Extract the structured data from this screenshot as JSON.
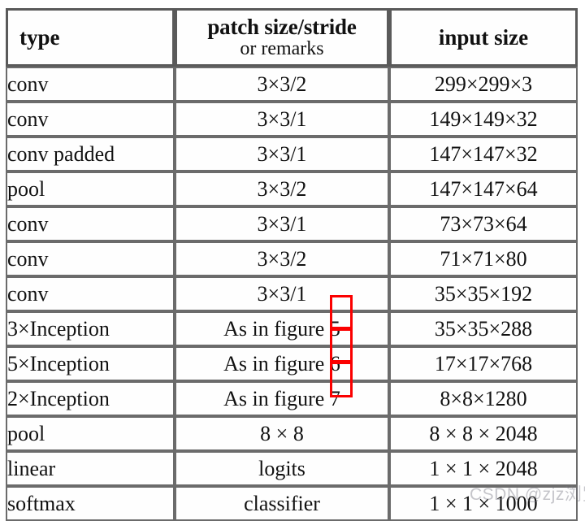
{
  "table": {
    "columns": [
      {
        "key": "type",
        "label": "type"
      },
      {
        "key": "patch",
        "label_line1": "patch size/stride",
        "label_line2": "or remarks"
      },
      {
        "key": "input",
        "label": "input size"
      }
    ],
    "rows": [
      {
        "type": "conv",
        "patch": "3×3/2",
        "input": "299×299×3"
      },
      {
        "type": "conv",
        "patch": "3×3/1",
        "input": "149×149×32"
      },
      {
        "type": "conv padded",
        "patch": "3×3/1",
        "input": "147×147×32"
      },
      {
        "type": "pool",
        "patch": "3×3/2",
        "input": "147×147×64"
      },
      {
        "type": "conv",
        "patch": "3×3/1",
        "input": "73×73×64"
      },
      {
        "type": "conv",
        "patch": "3×3/2",
        "input": "71×71×80"
      },
      {
        "type": "conv",
        "patch": "3×3/1",
        "input": "35×35×192"
      },
      {
        "type": "3×Inception",
        "patch": "As in figure 5",
        "input": "35×35×288"
      },
      {
        "type": "5×Inception",
        "patch": "As in figure 6",
        "input": "17×17×768"
      },
      {
        "type": "2×Inception",
        "patch": "As in figure 7",
        "input": "8×8×1280"
      },
      {
        "type": "pool",
        "patch": "8 × 8",
        "input": "8 × 8 × 2048"
      },
      {
        "type": "linear",
        "patch": "logits",
        "input": "1 × 1 × 2048"
      },
      {
        "type": "softmax",
        "patch": "classifier",
        "input": "1 × 1 × 1000"
      }
    ]
  },
  "annotations": {
    "highlight_color": "#fb0000",
    "boxes": [
      {
        "id": "fig-box-5",
        "target": "figure number 5"
      },
      {
        "id": "fig-box-6",
        "target": "figure number 6"
      },
      {
        "id": "fig-box-7",
        "target": "figure number 7"
      }
    ]
  },
  "watermark": {
    "text": "CSDN @zjz浏览"
  }
}
